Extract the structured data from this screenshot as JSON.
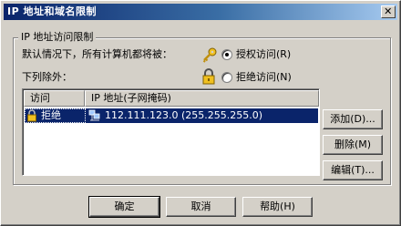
{
  "window": {
    "title": "IP 地址和域名限制"
  },
  "group": {
    "title": "IP 地址访问限制",
    "default_prompt": "默认情况下，所有计算机都将被：",
    "radio_grant": {
      "label": "授权访问(R)",
      "checked": true
    },
    "radio_deny": {
      "label": "拒绝访问(N)",
      "checked": false
    },
    "exceptions_label": "下列除外："
  },
  "list": {
    "columns": [
      "访问",
      "IP 地址(子网掩码)"
    ],
    "rows": [
      {
        "access": "拒绝",
        "address": "112.111.123.0  (255.255.255.0)"
      }
    ]
  },
  "side_buttons": {
    "add": "添加(D)...",
    "remove": "删除(M)",
    "edit": "编辑(T)..."
  },
  "footer_buttons": {
    "ok": "确定",
    "cancel": "取消",
    "help": "帮助(H)"
  },
  "icons": {
    "key": "key-icon",
    "lock": "padlock-icon",
    "computer": "network-computers-icon",
    "close": "close-icon"
  }
}
